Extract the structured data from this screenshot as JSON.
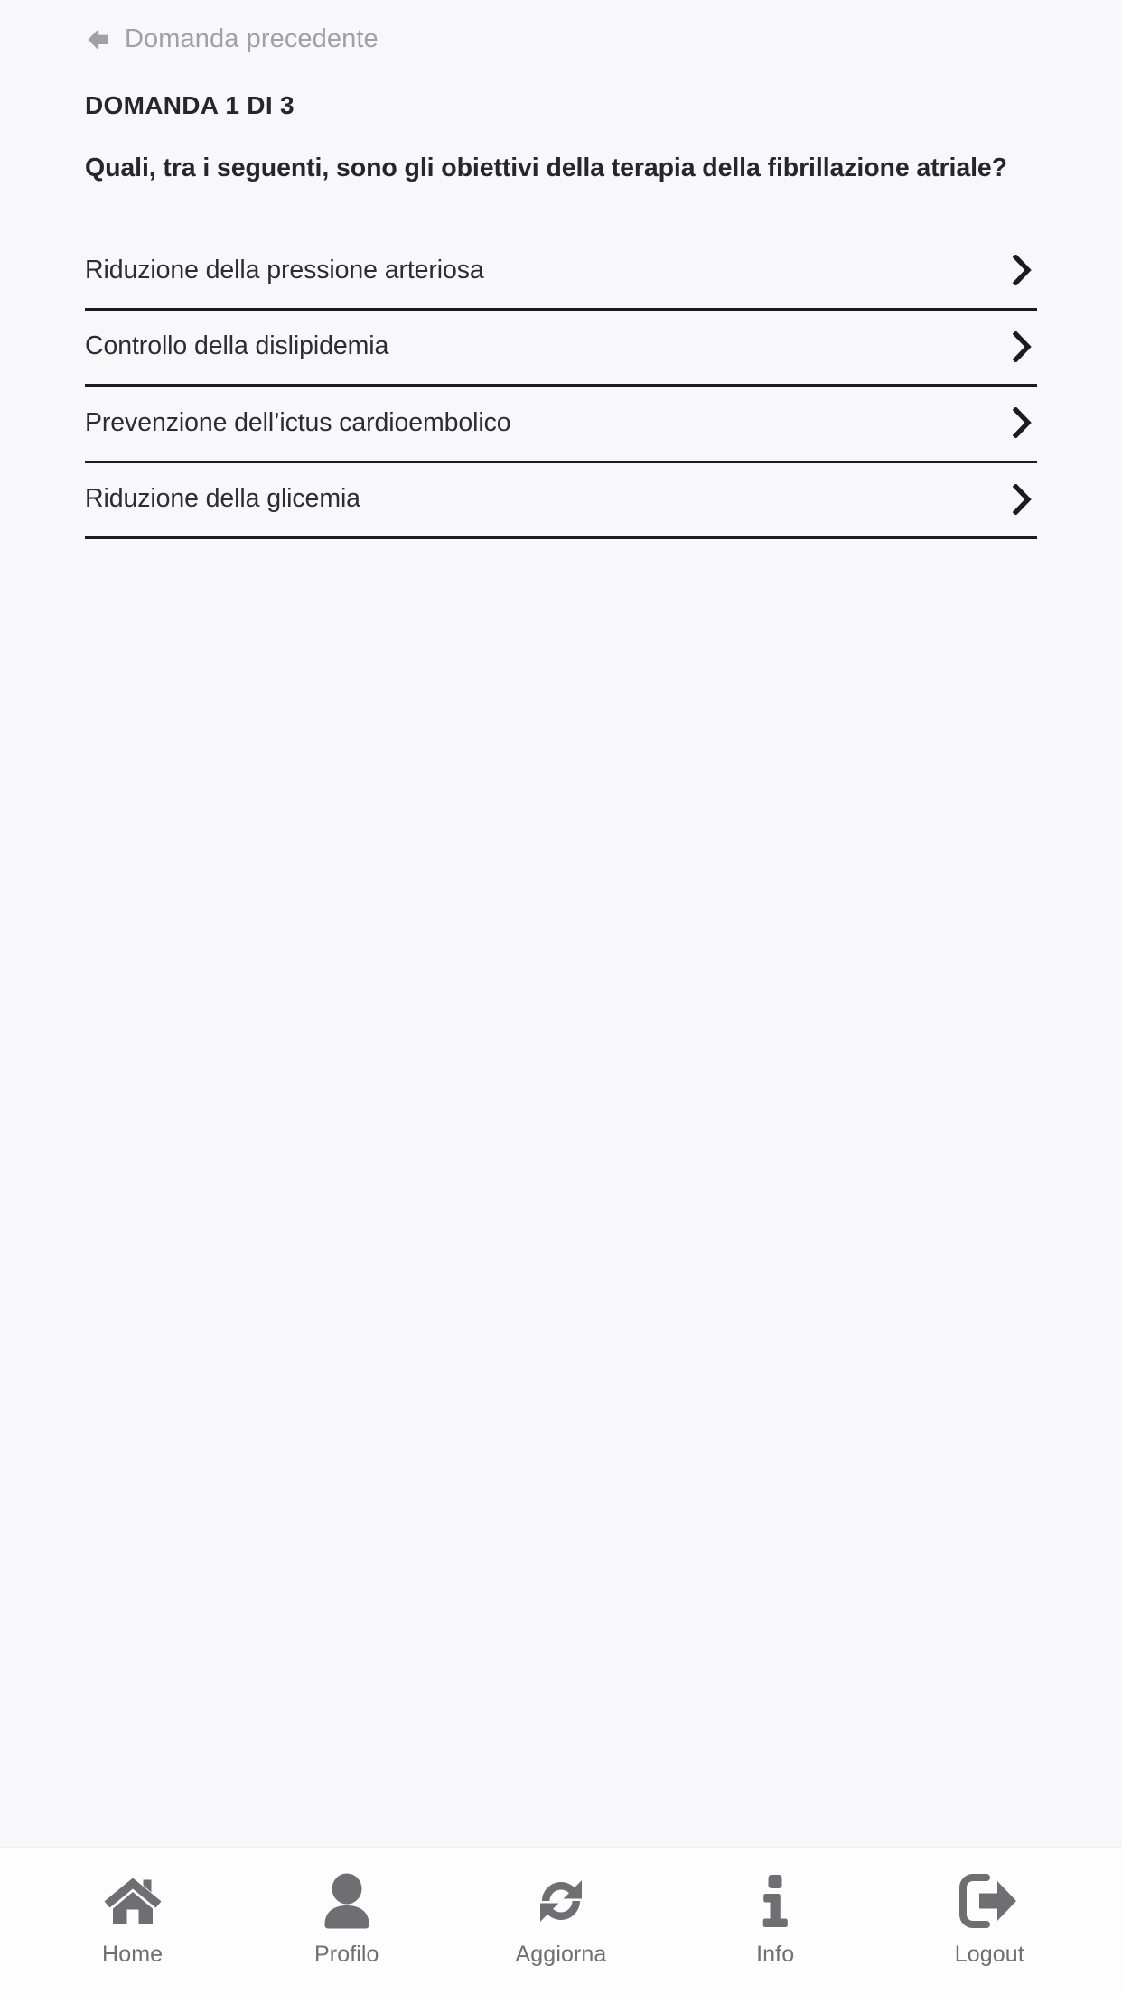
{
  "header": {
    "back_label": "Domanda precedente",
    "back_icon": "arrow-left-icon"
  },
  "question": {
    "counter": "DOMANDA 1 DI 3",
    "text": "Quali, tra i seguenti, sono gli obiettivi della terapia della fibrillazione atriale?"
  },
  "answers": [
    {
      "label": "Riduzione della pressione arteriosa",
      "icon": "chevron-right-icon"
    },
    {
      "label": "Controllo della dislipidemia",
      "icon": "chevron-right-icon"
    },
    {
      "label": "Prevenzione dell’ictus cardioembolico",
      "icon": "chevron-right-icon"
    },
    {
      "label": "Riduzione della glicemia",
      "icon": "chevron-right-icon"
    }
  ],
  "tabbar": {
    "items": [
      {
        "label": "Home",
        "icon": "home-icon"
      },
      {
        "label": "Profilo",
        "icon": "person-icon"
      },
      {
        "label": "Aggiorna",
        "icon": "refresh-icon"
      },
      {
        "label": "Info",
        "icon": "info-icon"
      },
      {
        "label": "Logout",
        "icon": "logout-icon"
      }
    ]
  },
  "colors": {
    "background": "#f8f8fa",
    "tabbar_background": "#fdfdfe",
    "text_primary": "#26262b",
    "text_muted": "#a0a0a5",
    "divider": "#1b1b20",
    "icon_gray": "#6e6e73"
  }
}
